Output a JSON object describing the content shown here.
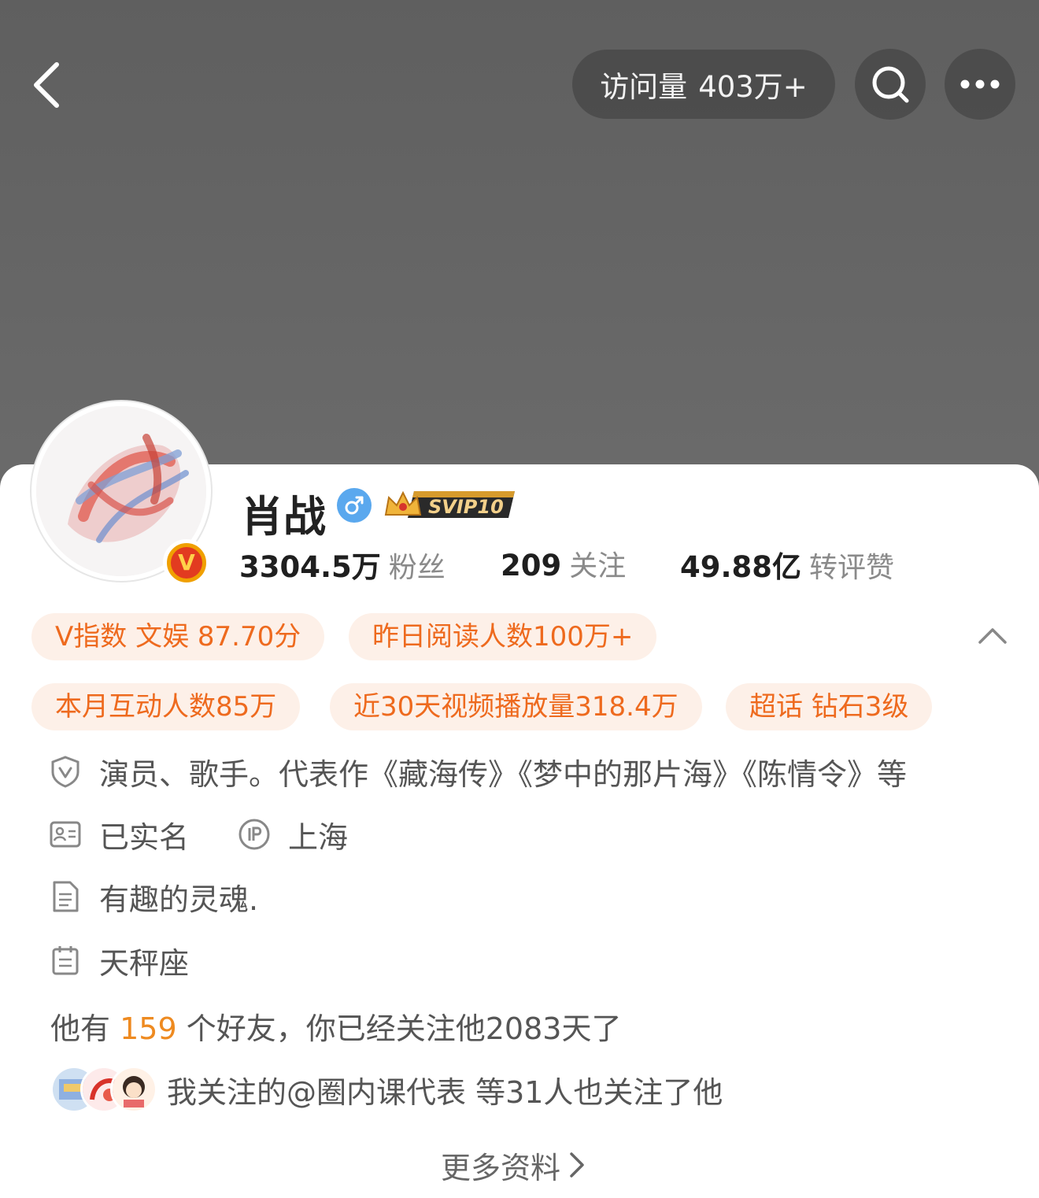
{
  "header": {
    "visit_label": "访问量",
    "visit_count": "403万+"
  },
  "profile": {
    "name": "肖战",
    "gender": "male",
    "svip_badge": "SVIP10",
    "verified_badge": "V"
  },
  "stats": [
    {
      "value": "3304.5万",
      "label": "粉丝"
    },
    {
      "value": "209",
      "label": "关注"
    },
    {
      "value": "49.88亿",
      "label": "转评赞"
    }
  ],
  "tags": [
    "V指数 文娱 87.70分",
    "昨日阅读人数100万+",
    "本月互动人数85万",
    "近30天视频播放量318.4万",
    "超话 钻石3级"
  ],
  "info": {
    "verification": "演员、歌手。代表作《藏海传》《梦中的那片海》《陈情令》等",
    "real_name": "已实名",
    "ip_location": "上海",
    "bio": "有趣的灵魂.",
    "zodiac": "天秤座"
  },
  "friends": {
    "prefix": "他有",
    "count": "159",
    "suffix": "个好友，你已经关注他2083天了"
  },
  "mutual": {
    "text": "我关注的@圈内课代表  等31人也关注了他"
  },
  "more_info_label": "更多资料",
  "colors": {
    "accent": "#ee6a1e",
    "tag_bg": "#fdf0e8",
    "highlight": "#ee8a20",
    "cover": "#666666"
  },
  "icons": [
    "back-icon",
    "search-icon",
    "more-dots-icon",
    "male-icon",
    "crown-icon",
    "collapse-chevron-icon",
    "shield-v-icon",
    "id-card-icon",
    "ip-icon",
    "document-icon",
    "calendar-icon",
    "chevron-right-icon"
  ]
}
